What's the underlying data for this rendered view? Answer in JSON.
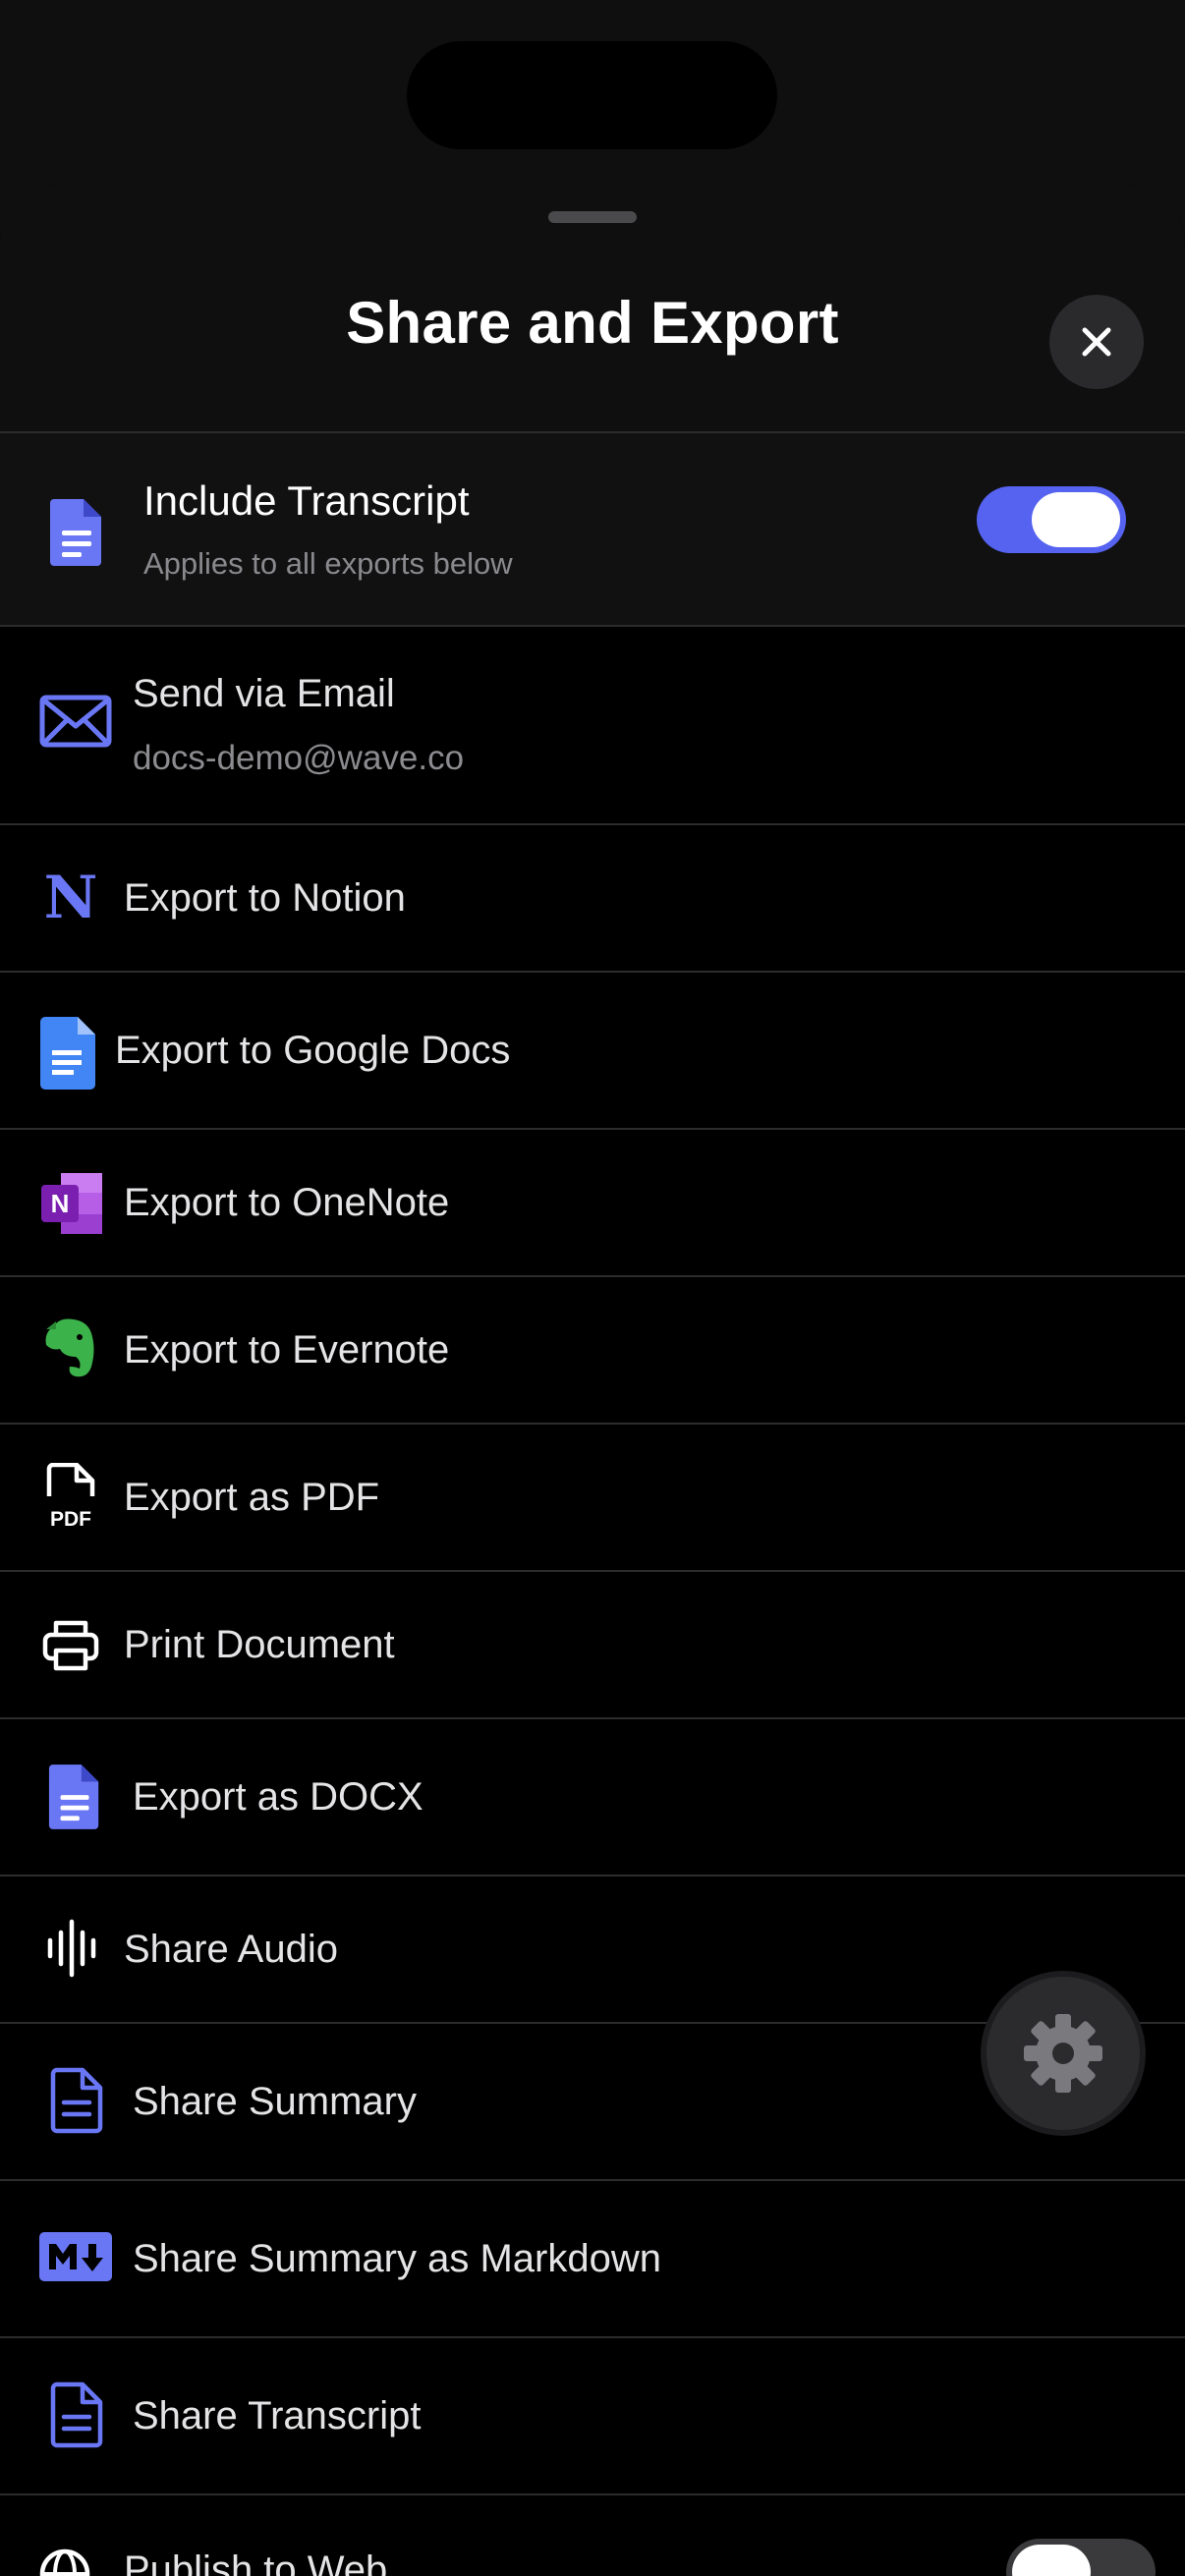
{
  "sheet": {
    "title": "Share and Export"
  },
  "include_transcript": {
    "label": "Include Transcript",
    "subtitle": "Applies to all exports below",
    "enabled": true,
    "icon": "document-icon"
  },
  "options": [
    {
      "id": "email",
      "label": "Send via Email",
      "subtitle": "docs-demo@wave.co",
      "icon": "mail-icon"
    },
    {
      "id": "notion",
      "label": "Export to Notion",
      "icon": "notion-icon"
    },
    {
      "id": "google-docs",
      "label": "Export to Google Docs",
      "icon": "google-docs-icon"
    },
    {
      "id": "onenote",
      "label": "Export to OneNote",
      "icon": "onenote-icon"
    },
    {
      "id": "evernote",
      "label": "Export to Evernote",
      "icon": "evernote-icon"
    },
    {
      "id": "pdf",
      "label": "Export as PDF",
      "icon": "pdf-icon"
    },
    {
      "id": "print",
      "label": "Print Document",
      "icon": "printer-icon"
    },
    {
      "id": "docx",
      "label": "Export as DOCX",
      "icon": "document-icon"
    },
    {
      "id": "audio",
      "label": "Share Audio",
      "icon": "waveform-icon"
    },
    {
      "id": "summary",
      "label": "Share Summary",
      "icon": "document-outline-icon"
    },
    {
      "id": "markdown",
      "label": "Share Summary as Markdown",
      "icon": "markdown-icon"
    },
    {
      "id": "transcript",
      "label": "Share Transcript",
      "icon": "document-outline-icon"
    },
    {
      "id": "publish",
      "label": "Publish to Web",
      "icon": "globe-icon",
      "toggle_enabled": false
    }
  ],
  "colors": {
    "accent": "#5563f0",
    "google_docs": "#4285f4",
    "onenote": "#8a2fc4",
    "evernote": "#3bb24a"
  }
}
